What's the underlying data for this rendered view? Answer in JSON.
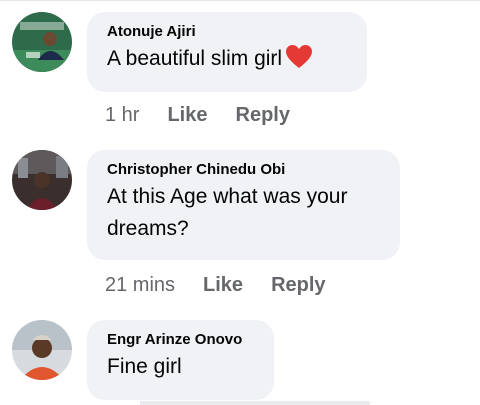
{
  "comments": [
    {
      "author": "Atonuje Ajiri",
      "text": "A beautiful slim girl",
      "emoji": "red-heart",
      "time": "1 hr",
      "like_label": "Like",
      "reply_label": "Reply"
    },
    {
      "author": "Christopher Chinedu Obi",
      "text_line1": "At this Age what was your",
      "text_line2": "dreams?",
      "time": "21 mins",
      "like_label": "Like",
      "reply_label": "Reply"
    },
    {
      "author": "Engr Arinze Onovo",
      "text": "Fine girl"
    }
  ],
  "colors": {
    "bubble": "#f0f2f5",
    "meta": "#65676b",
    "heart": "#e53935"
  }
}
